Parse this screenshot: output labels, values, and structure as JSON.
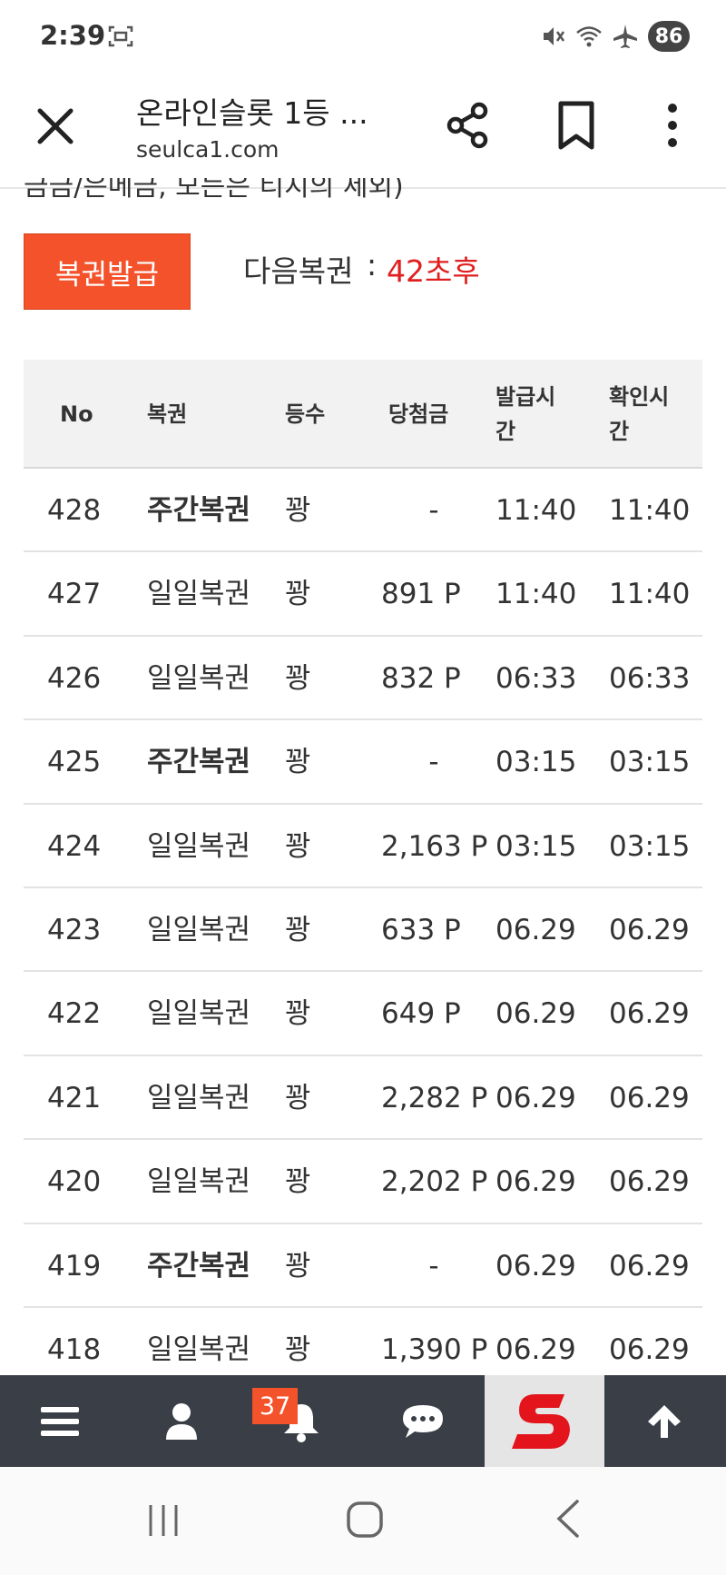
{
  "status_bar": {
    "time": "2:39",
    "battery": "86",
    "icons": [
      "screenshot-icon",
      "mute-icon",
      "wifi-icon",
      "airplane-icon"
    ]
  },
  "browser": {
    "title": "온라인슬롯 1등 ...",
    "url": "seulca1.com",
    "icons": [
      "close-icon",
      "share-icon",
      "bookmark-icon",
      "more-vert-icon"
    ]
  },
  "content": {
    "cut_off_text": "금금/은메금, 모든은 티지의 세외)",
    "issue_button": "복권발급",
    "next_label": "다음복권",
    "next_colon": ":",
    "next_value": "42초후"
  },
  "table": {
    "headers": {
      "no": "No",
      "type": "복권",
      "rank": "등수",
      "prize": "당첨금",
      "issue_line1": "발급시",
      "issue_line2": "간",
      "check_line1": "확인시",
      "check_line2": "간"
    },
    "rows": [
      {
        "no": "428",
        "type": "주간복권",
        "rank": "꽝",
        "prize": "-",
        "issue": "11:40",
        "check": "11:40"
      },
      {
        "no": "427",
        "type": "일일복권",
        "rank": "꽝",
        "prize": "891 P",
        "issue": "11:40",
        "check": "11:40"
      },
      {
        "no": "426",
        "type": "일일복권",
        "rank": "꽝",
        "prize": "832 P",
        "issue": "06:33",
        "check": "06:33"
      },
      {
        "no": "425",
        "type": "주간복권",
        "rank": "꽝",
        "prize": "-",
        "issue": "03:15",
        "check": "03:15"
      },
      {
        "no": "424",
        "type": "일일복권",
        "rank": "꽝",
        "prize": "2,163 P",
        "issue": "03:15",
        "check": "03:15"
      },
      {
        "no": "423",
        "type": "일일복권",
        "rank": "꽝",
        "prize": "633 P",
        "issue": "06.29",
        "check": "06.29"
      },
      {
        "no": "422",
        "type": "일일복권",
        "rank": "꽝",
        "prize": "649 P",
        "issue": "06.29",
        "check": "06.29"
      },
      {
        "no": "421",
        "type": "일일복권",
        "rank": "꽝",
        "prize": "2,282 P",
        "issue": "06.29",
        "check": "06.29"
      },
      {
        "no": "420",
        "type": "일일복권",
        "rank": "꽝",
        "prize": "2,202 P",
        "issue": "06.29",
        "check": "06.29"
      },
      {
        "no": "419",
        "type": "주간복권",
        "rank": "꽝",
        "prize": "-",
        "issue": "06.29",
        "check": "06.29"
      },
      {
        "no": "418",
        "type": "일일복권",
        "rank": "꽝",
        "prize": "1,390 P",
        "issue": "06.29",
        "check": "06.29"
      }
    ]
  },
  "app_bar": {
    "notification_count": "37",
    "icons": [
      "menu-icon",
      "user-icon",
      "bell-icon",
      "chat-icon",
      "site-logo",
      "arrow-up-icon"
    ]
  },
  "colors": {
    "accent": "#f4522b",
    "countdown": "#e02020",
    "app_bar_bg": "#3a3f47"
  }
}
